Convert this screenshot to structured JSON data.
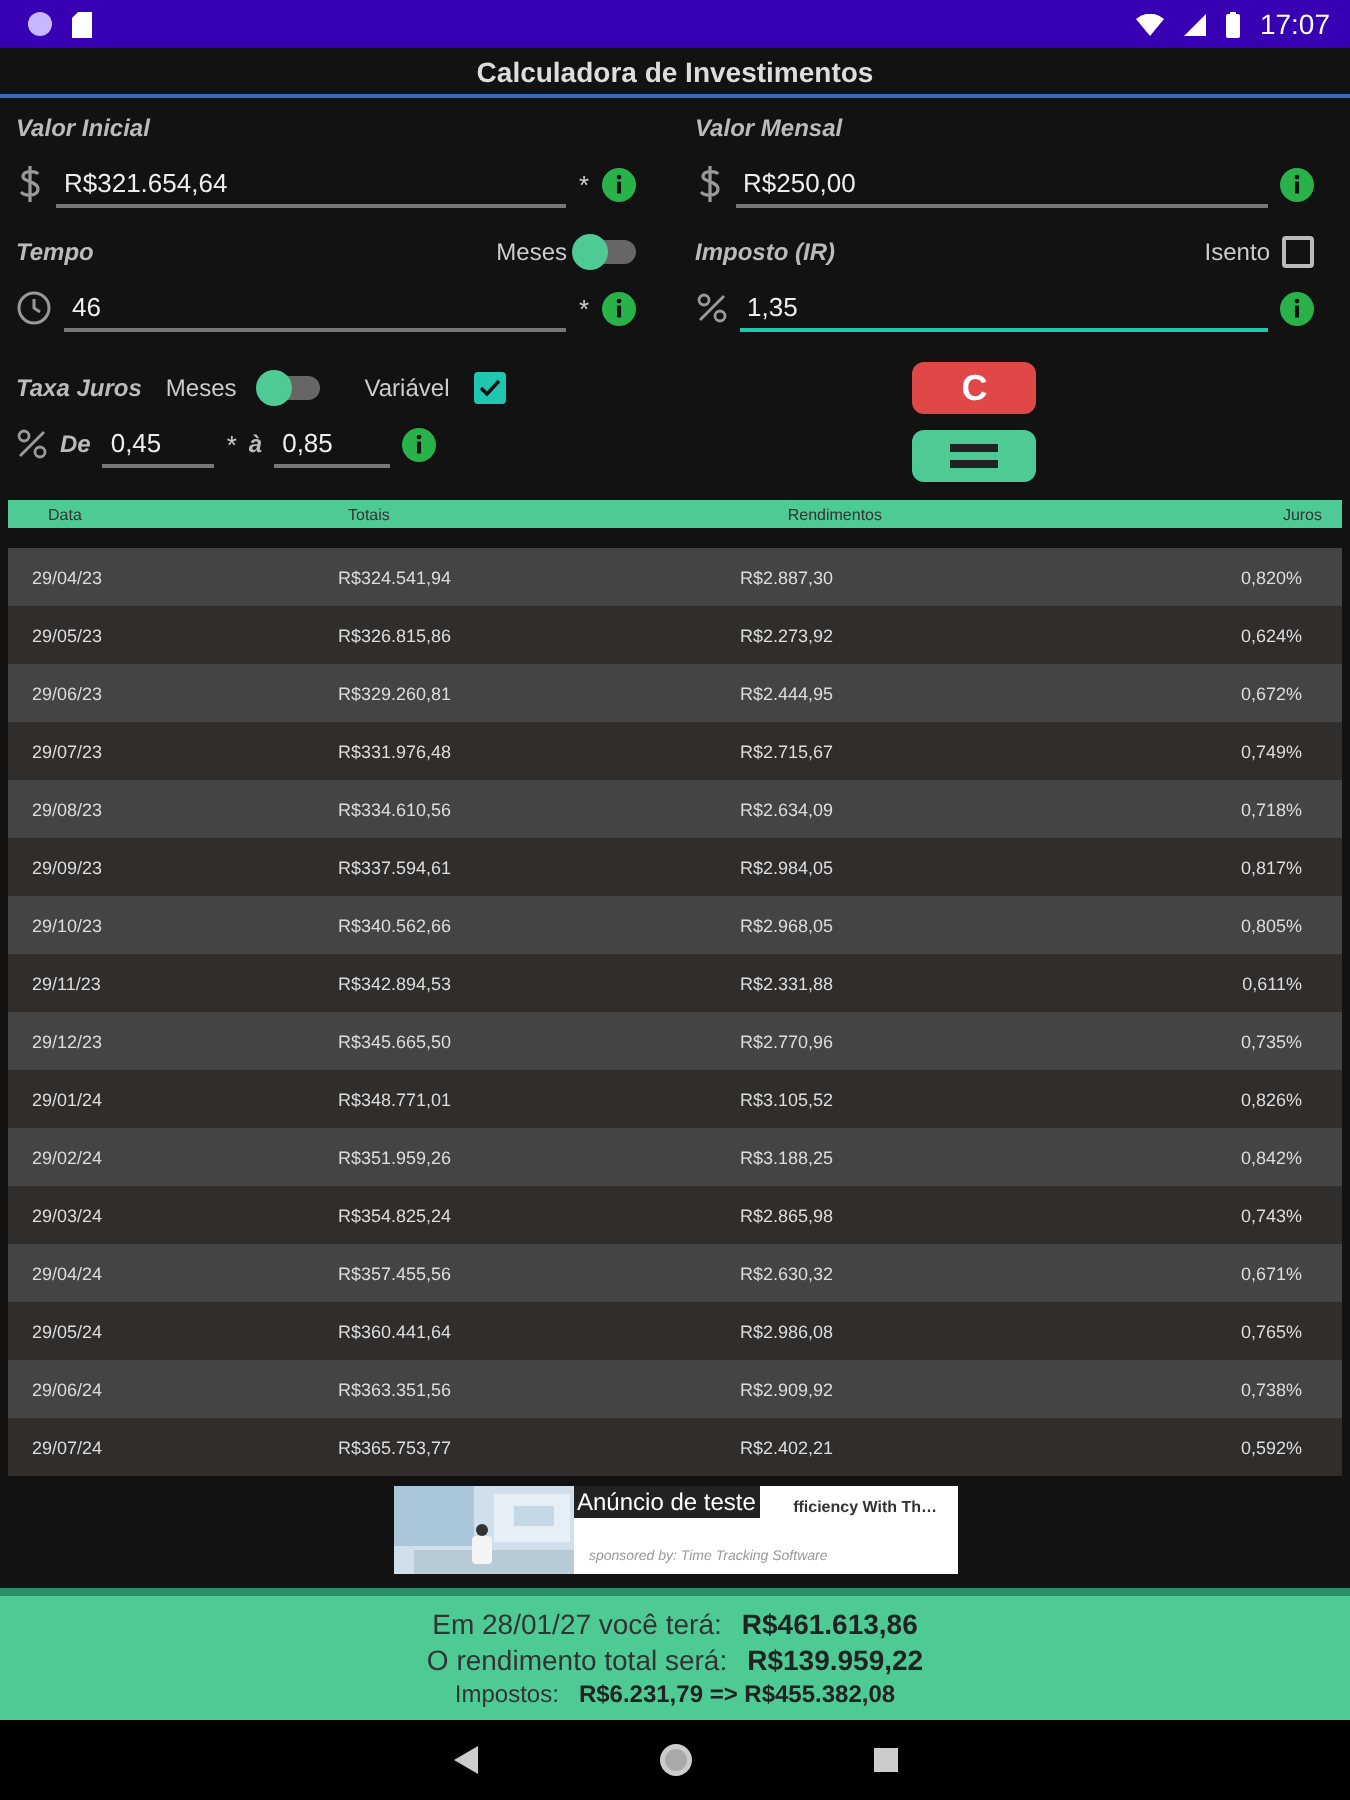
{
  "status_bar": {
    "time": "17:07"
  },
  "title": "Calculadora de Investimentos",
  "valor_inicial": {
    "label": "Valor Inicial",
    "value": "R$321.654,64",
    "required": "*",
    "focused": false
  },
  "valor_mensal": {
    "label": "Valor Mensal",
    "value": "R$250,00",
    "focused": false
  },
  "tempo": {
    "label": "Tempo",
    "switch_label": "Meses",
    "on": false,
    "value": "46",
    "required": "*",
    "focused": false
  },
  "imposto": {
    "label": "Imposto (IR)",
    "checkbox_label": "Isento",
    "checked": false,
    "value": "1,35",
    "focused": true
  },
  "taxa": {
    "label": "Taxa Juros",
    "switch_label": "Meses",
    "on": false,
    "checkbox_label": "Variável",
    "checked": true,
    "from_label": "De",
    "from_value": "0,45",
    "required": "*",
    "to_label": "à",
    "to_value": "0,85"
  },
  "buttons": {
    "clear": "C"
  },
  "table": {
    "columns": [
      "Data",
      "Totais",
      "Rendimentos",
      "Juros"
    ],
    "rows": [
      [
        "29/04/23",
        "R$324.541,94",
        "R$2.887,30",
        "0,820%"
      ],
      [
        "29/05/23",
        "R$326.815,86",
        "R$2.273,92",
        "0,624%"
      ],
      [
        "29/06/23",
        "R$329.260,81",
        "R$2.444,95",
        "0,672%"
      ],
      [
        "29/07/23",
        "R$331.976,48",
        "R$2.715,67",
        "0,749%"
      ],
      [
        "29/08/23",
        "R$334.610,56",
        "R$2.634,09",
        "0,718%"
      ],
      [
        "29/09/23",
        "R$337.594,61",
        "R$2.984,05",
        "0,817%"
      ],
      [
        "29/10/23",
        "R$340.562,66",
        "R$2.968,05",
        "0,805%"
      ],
      [
        "29/11/23",
        "R$342.894,53",
        "R$2.331,88",
        "0,611%"
      ],
      [
        "29/12/23",
        "R$345.665,50",
        "R$2.770,96",
        "0,735%"
      ],
      [
        "29/01/24",
        "R$348.771,01",
        "R$3.105,52",
        "0,826%"
      ],
      [
        "29/02/24",
        "R$351.959,26",
        "R$3.188,25",
        "0,842%"
      ],
      [
        "29/03/24",
        "R$354.825,24",
        "R$2.865,98",
        "0,743%"
      ],
      [
        "29/04/24",
        "R$357.455,56",
        "R$2.630,32",
        "0,671%"
      ],
      [
        "29/05/24",
        "R$360.441,64",
        "R$2.986,08",
        "0,765%"
      ],
      [
        "29/06/24",
        "R$363.351,56",
        "R$2.909,92",
        "0,738%"
      ],
      [
        "29/07/24",
        "R$365.753,77",
        "R$2.402,21",
        "0,592%"
      ]
    ]
  },
  "ad": {
    "badge": "Anúncio de teste",
    "headline": "fficiency With Th…",
    "sponsor": "sponsored by: Time Tracking Software"
  },
  "summary": [
    {
      "label": "Em 28/01/27 você terá:",
      "value": "R$461.613,86"
    },
    {
      "label": "O rendimento total será:",
      "value": "R$139.959,22"
    },
    {
      "label": "Impostos:",
      "value": "R$6.231,79 => R$455.382,08"
    }
  ]
}
